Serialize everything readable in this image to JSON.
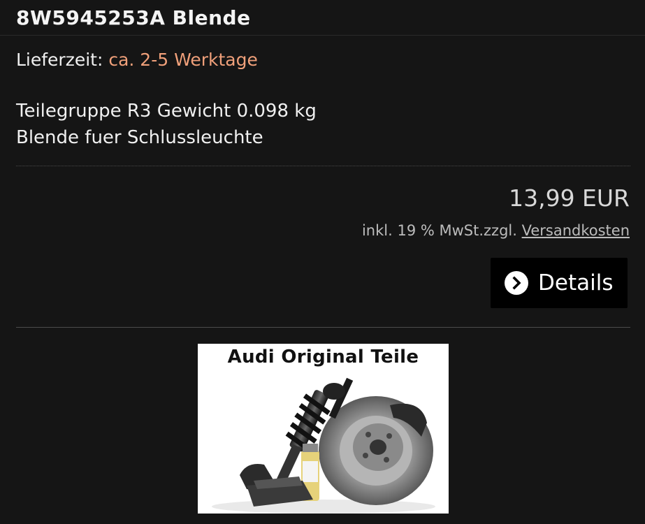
{
  "product": {
    "title": "8W5945253A Blende",
    "delivery_label": "Lieferzeit:",
    "delivery_value": "ca. 2-5 Werktage",
    "description_line1": "Teilegruppe R3 Gewicht 0.098 kg",
    "description_line2": "Blende fuer Schlussleuchte",
    "price": "13,99 EUR",
    "tax_text": "inkl. 19 % MwSt.zzgl.",
    "shipping_link": "Versandkosten",
    "details_button": "Details",
    "image_banner": "Audi Original Teile"
  },
  "colors": {
    "background": "#151515",
    "delivery_accent": "#f0a07a",
    "button_bg": "#000000"
  },
  "icons": {
    "details": "chevron-right-circle-icon"
  }
}
